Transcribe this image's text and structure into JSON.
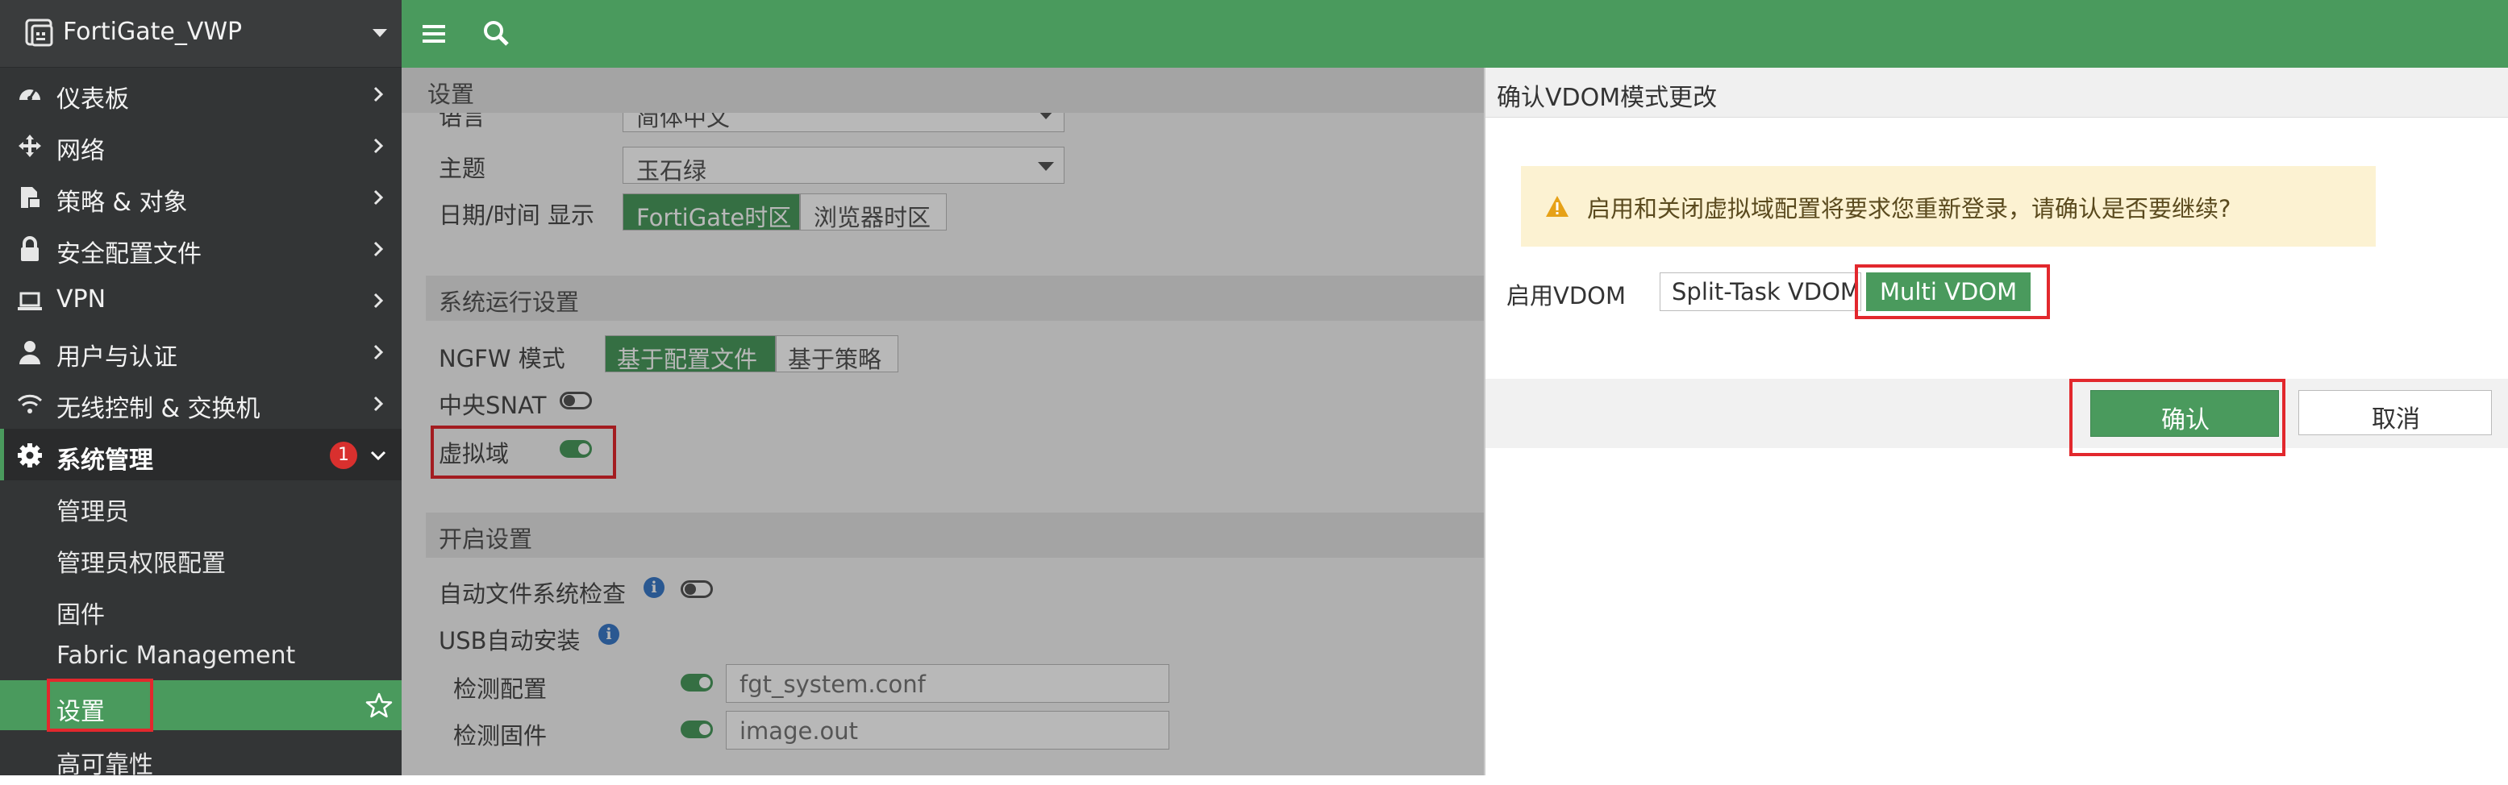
{
  "sidebar": {
    "device_name": "FortiGate_VWP",
    "items": [
      {
        "label": "仪表板",
        "icon": "dashboard-icon"
      },
      {
        "label": "网络",
        "icon": "network-move-icon"
      },
      {
        "label": "策略 & 对象",
        "icon": "policy-icon"
      },
      {
        "label": "安全配置文件",
        "icon": "lock-icon"
      },
      {
        "label": "VPN",
        "icon": "laptop-icon"
      },
      {
        "label": "用户与认证",
        "icon": "user-icon"
      },
      {
        "label": "无线控制 & 交换机",
        "icon": "wifi-icon"
      },
      {
        "label": "系统管理",
        "icon": "gear-icon",
        "badge": "1"
      }
    ],
    "subitems": [
      {
        "label": "管理员"
      },
      {
        "label": "管理员权限配置"
      },
      {
        "label": "固件"
      },
      {
        "label": "Fabric Management"
      },
      {
        "label": "设置"
      },
      {
        "label": "高可靠性"
      }
    ]
  },
  "settings": {
    "panel_title": "设置",
    "language_label": "语言",
    "language_value": "简体中文",
    "theme_label": "主题",
    "theme_value": "玉石绿",
    "datetime_label": "日期/时间 显示",
    "datetime_opt1": "FortiGate时区",
    "datetime_opt2": "浏览器时区",
    "runtime_section": "系统运行设置",
    "ngfw_label": "NGFW 模式",
    "ngfw_opt1": "基于配置文件",
    "ngfw_opt2": "基于策略",
    "central_snat_label": "中央SNAT",
    "vdom_label": "虚拟域",
    "startup_section": "开启设置",
    "auto_fs_check_label": "自动文件系统检查",
    "usb_install_label": "USB自动安装",
    "detect_config_label": "检测配置",
    "detect_config_value": "fgt_system.conf",
    "detect_firmware_label": "检测固件",
    "detect_firmware_value": "image.out"
  },
  "dialog": {
    "title": "确认VDOM模式更改",
    "warning": "启用和关闭虚拟域配置将要求您重新登录，请确认是否要继续?",
    "enable_vdom_label": "启用VDOM",
    "opt_split": "Split-Task VDOM",
    "opt_multi": "Multi VDOM",
    "confirm": "确认",
    "cancel": "取消"
  },
  "colors": {
    "brand_green": "#4a9a5d",
    "sidebar_bg": "#333536",
    "highlight_red": "#e2282d",
    "warning_bg": "#fcf2d2",
    "warning_icon": "#e6a117"
  }
}
